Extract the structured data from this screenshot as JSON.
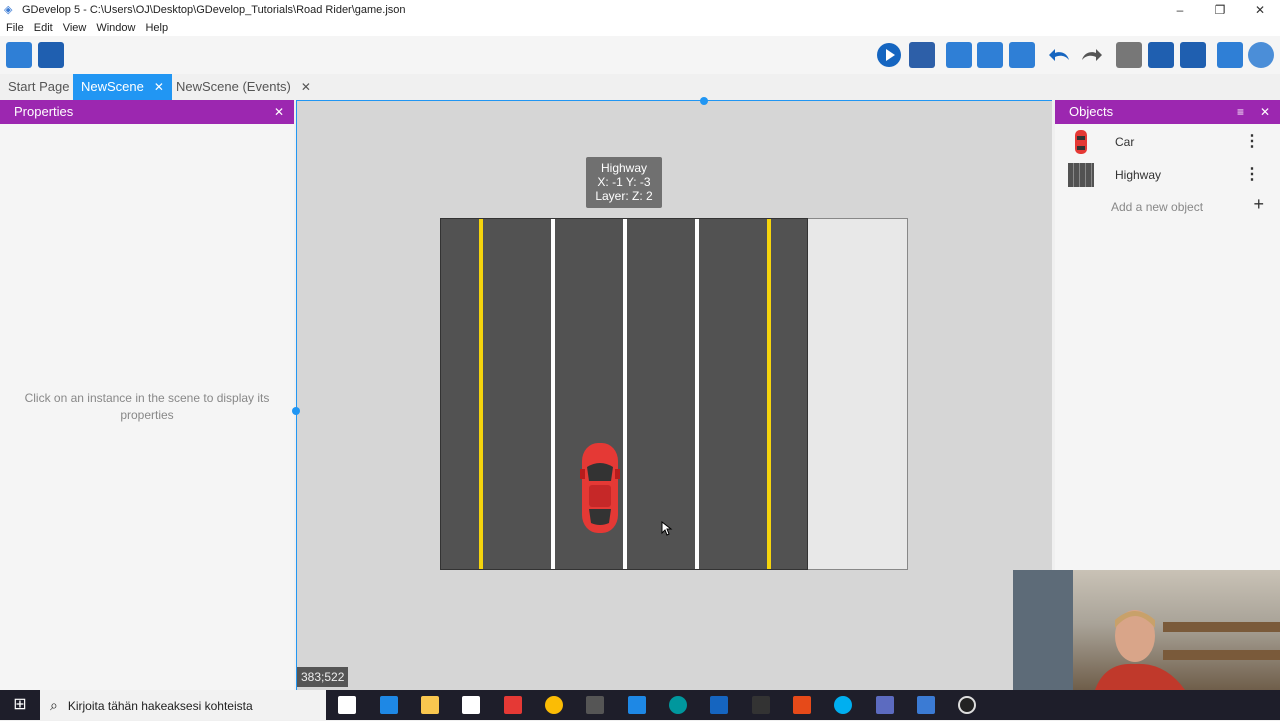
{
  "window": {
    "title": "GDevelop 5 - C:\\Users\\OJ\\Desktop\\GDevelop_Tutorials\\Road Rider\\game.json"
  },
  "menu": [
    "File",
    "Edit",
    "View",
    "Window",
    "Help"
  ],
  "tabs": [
    {
      "label": "Start Page"
    },
    {
      "label": "NewScene"
    },
    {
      "label": "NewScene (Events)"
    }
  ],
  "properties": {
    "title": "Properties",
    "hint": "Click on an instance in the scene to display its properties"
  },
  "tooltip": {
    "line1": "Highway",
    "line2": "X: -1  Y: -3",
    "line3": "Layer:   Z: 2"
  },
  "cursor_coords": "383;522",
  "objects": {
    "title": "Objects",
    "items": [
      {
        "name": "Car",
        "icon": "car-icon"
      },
      {
        "name": "Highway",
        "icon": "highway-icon"
      }
    ],
    "add_label": "Add a new object"
  },
  "taskbar": {
    "search_placeholder": "Kirjoita tähän hakeaksesi kohteista"
  },
  "colors": {
    "accent": "#2196f3",
    "panel_header": "#9c27b0",
    "road": "#525252",
    "lane_yellow": "#f5d40c",
    "lane_white": "#ffffff",
    "car": "#e53935"
  }
}
